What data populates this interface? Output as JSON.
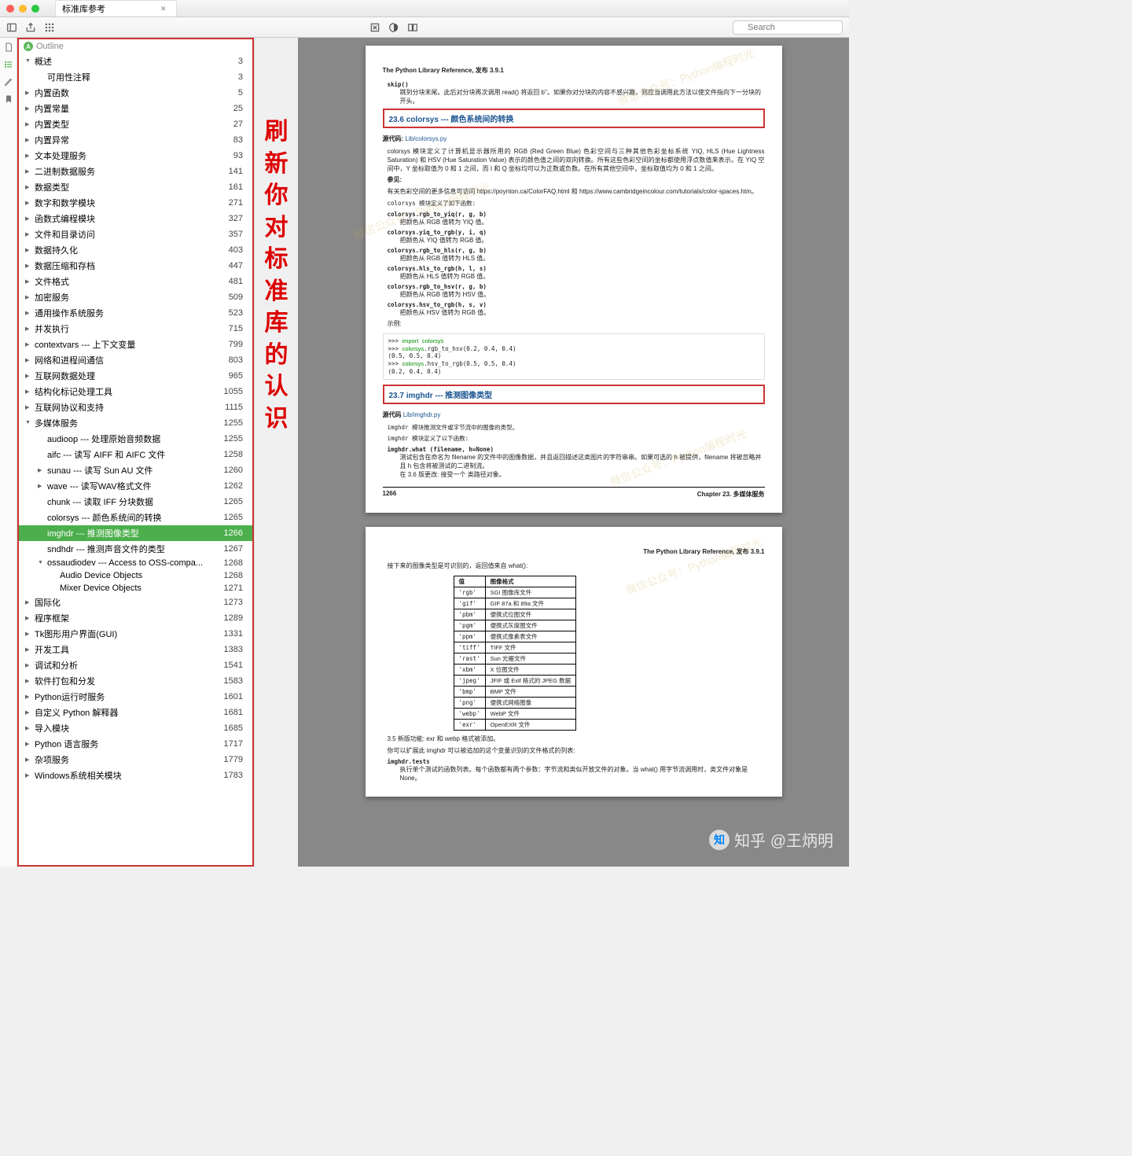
{
  "window": {
    "tab_title": "标准库参考"
  },
  "toolbar": {
    "search_placeholder": "Search"
  },
  "outline": {
    "head": "Outline",
    "items": [
      {
        "label": "概述",
        "page": 3,
        "level": 0,
        "exp": "open"
      },
      {
        "label": "可用性注释",
        "page": 3,
        "level": 1,
        "exp": "none"
      },
      {
        "label": "内置函数",
        "page": 5,
        "level": 0,
        "exp": "closed"
      },
      {
        "label": "内置常量",
        "page": 25,
        "level": 0,
        "exp": "closed"
      },
      {
        "label": "内置类型",
        "page": 27,
        "level": 0,
        "exp": "closed"
      },
      {
        "label": "内置异常",
        "page": 83,
        "level": 0,
        "exp": "closed"
      },
      {
        "label": "文本处理服务",
        "page": 93,
        "level": 0,
        "exp": "closed"
      },
      {
        "label": "二进制数据服务",
        "page": 141,
        "level": 0,
        "exp": "closed"
      },
      {
        "label": "数据类型",
        "page": 161,
        "level": 0,
        "exp": "closed"
      },
      {
        "label": "数字和数学模块",
        "page": 271,
        "level": 0,
        "exp": "closed"
      },
      {
        "label": "函数式编程模块",
        "page": 327,
        "level": 0,
        "exp": "closed"
      },
      {
        "label": "文件和目录访问",
        "page": 357,
        "level": 0,
        "exp": "closed"
      },
      {
        "label": "数据持久化",
        "page": 403,
        "level": 0,
        "exp": "closed"
      },
      {
        "label": "数据压缩和存档",
        "page": 447,
        "level": 0,
        "exp": "closed"
      },
      {
        "label": "文件格式",
        "page": 481,
        "level": 0,
        "exp": "closed"
      },
      {
        "label": "加密服务",
        "page": 509,
        "level": 0,
        "exp": "closed"
      },
      {
        "label": "通用操作系统服务",
        "page": 523,
        "level": 0,
        "exp": "closed"
      },
      {
        "label": "并发执行",
        "page": 715,
        "level": 0,
        "exp": "closed"
      },
      {
        "label": "contextvars --- 上下文变量",
        "page": 799,
        "level": 0,
        "exp": "closed"
      },
      {
        "label": "网络和进程间通信",
        "page": 803,
        "level": 0,
        "exp": "closed"
      },
      {
        "label": "互联网数据处理",
        "page": 965,
        "level": 0,
        "exp": "closed"
      },
      {
        "label": "结构化标记处理工具",
        "page": 1055,
        "level": 0,
        "exp": "closed"
      },
      {
        "label": "互联网协议和支持",
        "page": 1115,
        "level": 0,
        "exp": "closed"
      },
      {
        "label": "多媒体服务",
        "page": 1255,
        "level": 0,
        "exp": "open"
      },
      {
        "label": "audioop --- 处理原始音频数据",
        "page": 1255,
        "level": 1,
        "exp": "none"
      },
      {
        "label": "aifc --- 读写 AIFF 和 AIFC 文件",
        "page": 1258,
        "level": 1,
        "exp": "none"
      },
      {
        "label": "sunau --- 读写 Sun AU 文件",
        "page": 1260,
        "level": 1,
        "exp": "closed"
      },
      {
        "label": "wave --- 读写WAV格式文件",
        "page": 1262,
        "level": 1,
        "exp": "closed"
      },
      {
        "label": "chunk --- 读取 IFF 分块数据",
        "page": 1265,
        "level": 1,
        "exp": "none"
      },
      {
        "label": "colorsys --- 颜色系统间的转换",
        "page": 1265,
        "level": 1,
        "exp": "none"
      },
      {
        "label": "imghdr --- 推测图像类型",
        "page": 1266,
        "level": 1,
        "exp": "none",
        "sel": true
      },
      {
        "label": "sndhdr --- 推测声音文件的类型",
        "page": 1267,
        "level": 1,
        "exp": "none"
      },
      {
        "label": "ossaudiodev --- Access to OSS-compa...",
        "page": 1268,
        "level": 1,
        "exp": "open"
      },
      {
        "label": "Audio Device Objects",
        "page": 1268,
        "level": 2,
        "exp": "none"
      },
      {
        "label": "Mixer Device Objects",
        "page": 1271,
        "level": 2,
        "exp": "none"
      },
      {
        "label": "国际化",
        "page": 1273,
        "level": 0,
        "exp": "closed"
      },
      {
        "label": "程序框架",
        "page": 1289,
        "level": 0,
        "exp": "closed"
      },
      {
        "label": "Tk图形用户界面(GUI)",
        "page": 1331,
        "level": 0,
        "exp": "closed"
      },
      {
        "label": "开发工具",
        "page": 1383,
        "level": 0,
        "exp": "closed"
      },
      {
        "label": "调试和分析",
        "page": 1541,
        "level": 0,
        "exp": "closed"
      },
      {
        "label": "软件打包和分发",
        "page": 1583,
        "level": 0,
        "exp": "closed"
      },
      {
        "label": "Python运行时服务",
        "page": 1601,
        "level": 0,
        "exp": "closed"
      },
      {
        "label": "自定义 Python 解释器",
        "page": 1681,
        "level": 0,
        "exp": "closed"
      },
      {
        "label": "导入模块",
        "page": 1685,
        "level": 0,
        "exp": "closed"
      },
      {
        "label": "Python 语言服务",
        "page": 1717,
        "level": 0,
        "exp": "closed"
      },
      {
        "label": "杂项服务",
        "page": 1779,
        "level": 0,
        "exp": "closed"
      },
      {
        "label": "Windows系统相关模块",
        "page": 1783,
        "level": 0,
        "exp": "closed"
      }
    ]
  },
  "annotation": "刷新你对标准库的认识",
  "doc": {
    "running_head": "The Python Library Reference, 发布 3.9.1",
    "page1": {
      "skip_fn": "skip()",
      "skip_desc": "跳到分块末尾。此后对分块再次调用 read() 将返回 b''。如果你对分块的内容不感兴趣，则应当调用此方法以使文件指向下一分块的开头。",
      "sec23_6": "23.6 colorsys --- 颜色系统间的转换",
      "src1_label": "源代码:",
      "src1_path": "Lib/colorsys.py",
      "p1": "colorsys 模块定义了计算机显示器所用的 RGB (Red Green Blue) 色彩空间与三种其他色彩坐标系统 YIQ, HLS (Hue Lightness Saturation) 和 HSV (Hue Saturation Value) 表示的颜色值之间的双向转换。所有这些色彩空间的坐标都使用浮点数值来表示。在 YIQ 空间中，Y 坐标取值为 0 和 1 之间，而 I 和 Q 坐标均可以为正数或负数。在所有其他空间中，坐标取值均为 0 和 1 之间。",
      "see_label": "参见:",
      "see_text": "有关色彩空间的更多信息可访问 https://poynton.ca/ColorFAQ.html 和 https://www.cambridgeincolour.com/tutorials/color-spaces.htm。",
      "p2": "colorsys 模块定义了如下函数:",
      "funcs": [
        {
          "sig": "colorsys.rgb_to_yiq(r, g, b)",
          "desc": "把颜色从 RGB 值转为 YIQ 值。"
        },
        {
          "sig": "colorsys.yiq_to_rgb(y, i, q)",
          "desc": "把颜色从 YIQ 值转为 RGB 值。"
        },
        {
          "sig": "colorsys.rgb_to_hls(r, g, b)",
          "desc": "把颜色从 RGB 值转为 HLS 值。"
        },
        {
          "sig": "colorsys.hls_to_rgb(h, l, s)",
          "desc": "把颜色从 HLS 值转为 RGB 值。"
        },
        {
          "sig": "colorsys.rgb_to_hsv(r, g, b)",
          "desc": "把颜色从 RGB 值转为 HSV 值。"
        },
        {
          "sig": "colorsys.hsv_to_rgb(h, s, v)",
          "desc": "把颜色从 HSV 值转为 RGB 值。"
        }
      ],
      "ex_label": "示例:",
      "ex_lines": [
        ">>> import colorsys",
        ">>> colorsys.rgb_to_hsv(0.2, 0.4, 0.4)",
        "(0.5, 0.5, 0.4)",
        ">>> colorsys.hsv_to_rgb(0.5, 0.5, 0.4)",
        "(0.2, 0.4, 0.4)"
      ],
      "sec23_7": "23.7 imghdr --- 推测图像类型",
      "src2_label": "源代码",
      "src2_path": "Lib/imghdr.py",
      "p3": "imghdr 模块推测文件或字节流中的图像的类型。",
      "p4": "imghdr 模块定义了以下函数:",
      "what_sig": "imghdr.what (filename, h=None)",
      "what_desc": "测试包含在命名为 filename 的文件中的图像数据，并且返回描述这类图片的字符串串。如果可选的 h 被提供，filename 将被忽略并且 h 包含将被测试的二进制流。",
      "change": "在 3.6 版更改: 接受一个 类路径对象。",
      "foot_page": "1266",
      "foot_chap": "Chapter 23. 多媒体服务"
    },
    "page2": {
      "p1": "接下来的图像类型是可识别的，返回值来自 what():",
      "th1": "值",
      "th2": "图像格式",
      "rows": [
        [
          "'rgb'",
          "SGI 图像库文件"
        ],
        [
          "'gif'",
          "GIF 87a 和 89a 文件"
        ],
        [
          "'pbm'",
          "便携式位图文件"
        ],
        [
          "'pgm'",
          "便携式灰度图文件"
        ],
        [
          "'ppm'",
          "便携式像素表文件"
        ],
        [
          "'tiff'",
          "TIFF 文件"
        ],
        [
          "'rast'",
          "Sun 光栅文件"
        ],
        [
          "'xbm'",
          "X 位图文件"
        ],
        [
          "'jpeg'",
          "JFIF 或 Exif 格式的 JPEG 数据"
        ],
        [
          "'bmp'",
          "BMP 文件"
        ],
        [
          "'png'",
          "便携式网络图像"
        ],
        [
          "'webp'",
          "WebP 文件"
        ],
        [
          "'exr'",
          "OpenEXR 文件"
        ]
      ],
      "news": "3.5 新版功能: exr 和 webp 格式被添加。",
      "p2": "你可以扩展此 imghdr 可以被追加的这个变量识别的文件格式的列表:",
      "tests_sig": "imghdr.tests",
      "tests_desc": "执行单个测试的函数列表。每个函数都有两个参数：字节流和类似开放文件的对象。当 what() 用字节流调用时，类文件对象是 None。"
    }
  },
  "watermark": "微信公众号：Python编程时光",
  "author": "知乎 @王炳明"
}
